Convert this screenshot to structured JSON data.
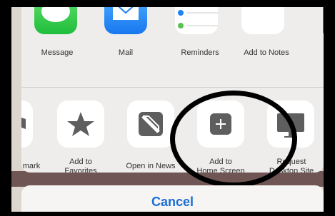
{
  "share_apps": [
    {
      "label": "Message",
      "icon": "messages-icon"
    },
    {
      "label": "Mail",
      "icon": "mail-icon"
    },
    {
      "label": "Reminders",
      "icon": "reminders-icon"
    },
    {
      "label": "Add to Notes",
      "icon": "notes-icon"
    }
  ],
  "actions": [
    {
      "label": "mark"
    },
    {
      "label": "Add to\nFavorites",
      "icon": "star-icon"
    },
    {
      "label": "Open in News",
      "icon": "news-icon"
    },
    {
      "label": "Add to\nHome Screen",
      "icon": "add-icon"
    },
    {
      "label": "Request\nDesktop Site",
      "icon": "desktop-icon"
    }
  ],
  "cancel_label": "Cancel",
  "colors": {
    "sheet": "#efedec",
    "cancel_text": "#1a6ed6",
    "annotation": "#000000"
  }
}
